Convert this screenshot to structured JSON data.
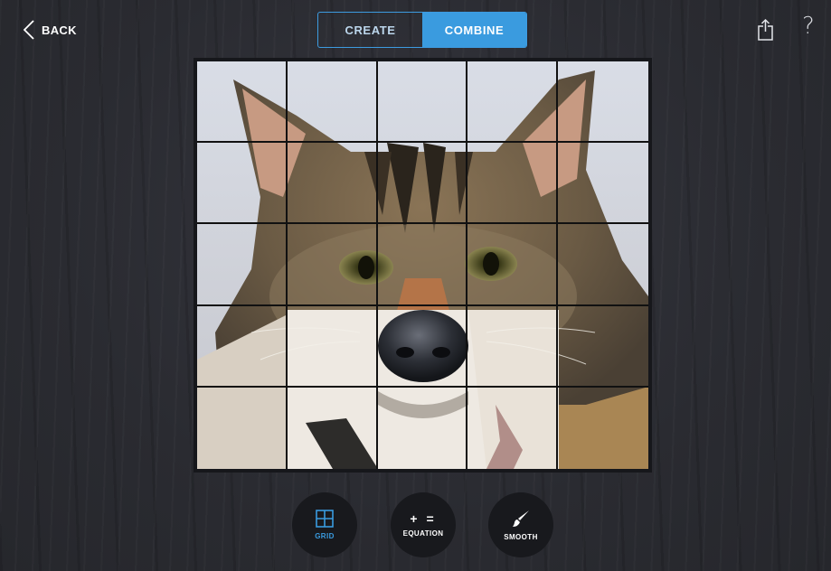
{
  "header": {
    "back_label": "BACK",
    "tabs": [
      {
        "label": "CREATE",
        "selected": false
      },
      {
        "label": "COMBINE",
        "selected": true
      }
    ],
    "share_icon": "share-icon",
    "help_label": "?"
  },
  "canvas": {
    "grid_rows": 5,
    "grid_cols": 5,
    "image_content": "cat face combined with dog muzzle"
  },
  "toolbar": {
    "tools": [
      {
        "label": "GRID",
        "icon": "grid-icon",
        "active": true
      },
      {
        "label": "EQUATION",
        "icon": "plus-equals-icon",
        "glyph": "+ =",
        "active": false
      },
      {
        "label": "SMOOTH",
        "icon": "brush-icon",
        "active": false
      }
    ]
  },
  "colors": {
    "accent": "#3a9bdf",
    "background": "#2b2c33",
    "button_bg": "#18191d"
  }
}
